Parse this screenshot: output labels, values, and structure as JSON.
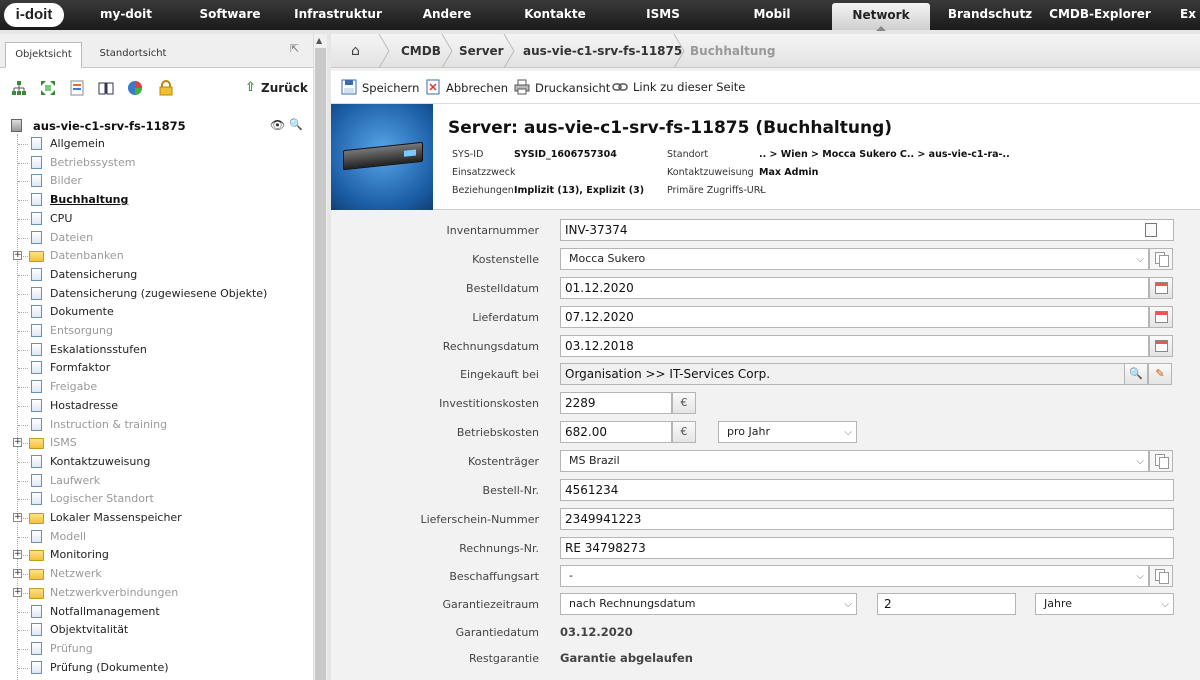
{
  "topnav": {
    "logo": "i-doit",
    "items": [
      {
        "label": "my-doit"
      },
      {
        "label": "Software"
      },
      {
        "label": "Infrastruktur"
      },
      {
        "label": "Andere"
      },
      {
        "label": "Kontakte"
      },
      {
        "label": "ISMS"
      },
      {
        "label": "Mobil"
      },
      {
        "label": "Network"
      },
      {
        "label": "Brandschutz"
      },
      {
        "label": "CMDB-Explorer"
      },
      {
        "label": "Ex"
      }
    ],
    "active": "Network"
  },
  "left": {
    "tabs": [
      {
        "label": "Objektsicht"
      },
      {
        "label": "Standortsicht"
      }
    ],
    "back_label": "Zurück",
    "toolbar_icons": [
      "tree-icon",
      "expand-icon",
      "form-icon",
      "book-icon",
      "pie-chart-icon",
      "lock-icon"
    ],
    "tree": {
      "root": "aus-vie-c1-srv-fs-11875",
      "items": [
        {
          "label": "Allgemein",
          "state": "filled",
          "type": "doc"
        },
        {
          "label": "Betriebssystem",
          "state": "empty",
          "type": "doc"
        },
        {
          "label": "Bilder",
          "state": "empty",
          "type": "doc"
        },
        {
          "label": "Buchhaltung",
          "state": "current",
          "type": "doc"
        },
        {
          "label": "CPU",
          "state": "filled",
          "type": "doc"
        },
        {
          "label": "Dateien",
          "state": "empty",
          "type": "doc"
        },
        {
          "label": "Datenbanken",
          "state": "empty",
          "type": "folder"
        },
        {
          "label": "Datensicherung",
          "state": "filled",
          "type": "doc"
        },
        {
          "label": "Datensicherung (zugewiesene Objekte)",
          "state": "filled",
          "type": "doc"
        },
        {
          "label": "Dokumente",
          "state": "filled",
          "type": "doc"
        },
        {
          "label": "Entsorgung",
          "state": "empty",
          "type": "doc"
        },
        {
          "label": "Eskalationsstufen",
          "state": "filled",
          "type": "doc"
        },
        {
          "label": "Formfaktor",
          "state": "filled",
          "type": "doc"
        },
        {
          "label": "Freigabe",
          "state": "empty",
          "type": "doc"
        },
        {
          "label": "Hostadresse",
          "state": "filled",
          "type": "doc"
        },
        {
          "label": "Instruction & training",
          "state": "empty",
          "type": "doc"
        },
        {
          "label": "ISMS",
          "state": "empty",
          "type": "folder"
        },
        {
          "label": "Kontaktzuweisung",
          "state": "filled",
          "type": "doc"
        },
        {
          "label": "Laufwerk",
          "state": "empty",
          "type": "doc"
        },
        {
          "label": "Logischer Standort",
          "state": "empty",
          "type": "doc"
        },
        {
          "label": "Lokaler Massenspeicher",
          "state": "filled",
          "type": "folder"
        },
        {
          "label": "Modell",
          "state": "empty",
          "type": "doc"
        },
        {
          "label": "Monitoring",
          "state": "filled",
          "type": "folder"
        },
        {
          "label": "Netzwerk",
          "state": "empty",
          "type": "folder"
        },
        {
          "label": "Netzwerkverbindungen",
          "state": "empty",
          "type": "folder"
        },
        {
          "label": "Notfallmanagement",
          "state": "filled",
          "type": "doc"
        },
        {
          "label": "Objektvitalität",
          "state": "filled",
          "type": "doc"
        },
        {
          "label": "Prüfung",
          "state": "empty",
          "type": "doc"
        },
        {
          "label": "Prüfung (Dokumente)",
          "state": "filled",
          "type": "doc"
        }
      ]
    }
  },
  "breadcrumb": [
    "CMDB",
    "Server",
    "aus-vie-c1-srv-fs-11875",
    "Buchhaltung"
  ],
  "actions": [
    {
      "label": "Speichern",
      "icon": "save-icon"
    },
    {
      "label": "Abbrechen",
      "icon": "cancel-icon"
    },
    {
      "label": "Druckansicht",
      "icon": "print-icon"
    },
    {
      "label": "Link zu dieser Seite",
      "icon": "link-icon"
    }
  ],
  "header": {
    "title": "Server: aus-vie-c1-srv-fs-11875 (Buchhaltung)",
    "sysid_label": "SYS-ID",
    "sysid": "SYSID_1606757304",
    "einsatz_label": "Einsatzzweck",
    "einsatz": "",
    "beziehungen_label": "Beziehungen",
    "beziehungen": "Implizit (13), Explizit (3)",
    "standort_label": "Standort",
    "standort": ".. > Wien > Mocca Sukero C.. > aus-vie-c1-ra-..",
    "kontakt_label": "Kontaktzuweisung",
    "kontakt": "Max Admin",
    "url_label": "Primäre Zugriffs-URL",
    "url": "-"
  },
  "form": {
    "inventarnummer": {
      "label": "Inventarnummer",
      "value": "INV-37374"
    },
    "kostenstelle": {
      "label": "Kostenstelle",
      "value": "Mocca Sukero"
    },
    "bestelldatum": {
      "label": "Bestelldatum",
      "value": "01.12.2020"
    },
    "lieferdatum": {
      "label": "Lieferdatum",
      "value": "07.12.2020"
    },
    "rechnungsdatum": {
      "label": "Rechnungsdatum",
      "value": "03.12.2018"
    },
    "eingekauft_bei": {
      "label": "Eingekauft bei",
      "value": "Organisation >> IT-Services Corp."
    },
    "investitionskosten": {
      "label": "Investitionskosten",
      "value": "2289",
      "currency": "€"
    },
    "betriebskosten": {
      "label": "Betriebskosten",
      "value": "682.00",
      "currency": "€",
      "interval": "pro Jahr"
    },
    "kostentraeger": {
      "label": "Kostenträger",
      "value": "MS Brazil"
    },
    "bestell_nr": {
      "label": "Bestell-Nr.",
      "value": "4561234"
    },
    "lieferschein": {
      "label": "Lieferschein-Nummer",
      "value": "2349941223"
    },
    "rechnungs_nr": {
      "label": "Rechnungs-Nr.",
      "value": "RE 34798273"
    },
    "beschaffungsart": {
      "label": "Beschaffungsart",
      "value": "-"
    },
    "garantiezeitraum": {
      "label": "Garantiezeitraum",
      "basis": "nach Rechnungsdatum",
      "amount": "2",
      "unit": "Jahre"
    },
    "garantiedatum": {
      "label": "Garantiedatum",
      "value": "03.12.2020"
    },
    "restgarantie": {
      "label": "Restgarantie",
      "value": "Garantie abgelaufen"
    }
  }
}
